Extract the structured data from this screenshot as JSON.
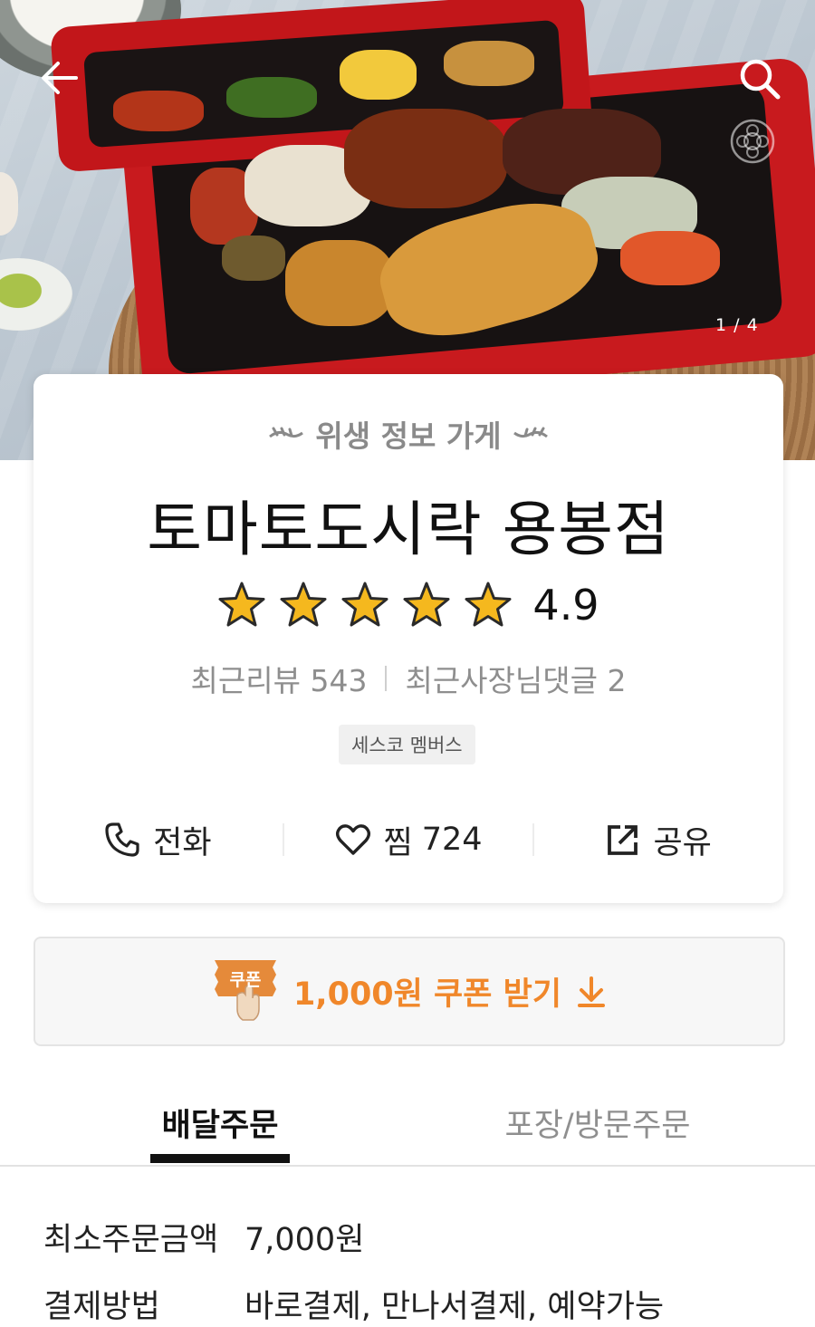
{
  "hero": {
    "image_counter": "1 / 4"
  },
  "store": {
    "hygiene_label": "위생 정보 가게",
    "name": "토마토도시락 용봉점",
    "rating": "4.9",
    "rating_stars": 5,
    "recent_reviews": "최근리뷰 543",
    "owner_replies": "최근사장님댓글 2",
    "badge": "세스코 멤버스"
  },
  "actions": {
    "call": "전화",
    "favorite_label": "찜",
    "favorite_count": "724",
    "share": "공유"
  },
  "coupon": {
    "tag": "쿠폰",
    "text": "1,000원 쿠폰 받기"
  },
  "tabs": [
    {
      "label": "배달주문",
      "active": true
    },
    {
      "label": "포장/방문주문",
      "active": false
    }
  ],
  "info": {
    "min_order_label": "최소주문금액",
    "min_order_value": "7,000원",
    "payment_label": "결제방법",
    "payment_value": "바로결제, 만나서결제, 예약가능"
  },
  "colors": {
    "accent": "#f0872a",
    "star": "#f5b81e",
    "text": "#111111",
    "muted": "#8e8e8e"
  },
  "icons": [
    "back-arrow-icon",
    "search-icon",
    "emblem-icon",
    "laurel-icon",
    "star-icon",
    "phone-icon",
    "heart-icon",
    "share-icon",
    "coupon-tag-icon",
    "download-arrow-icon"
  ]
}
